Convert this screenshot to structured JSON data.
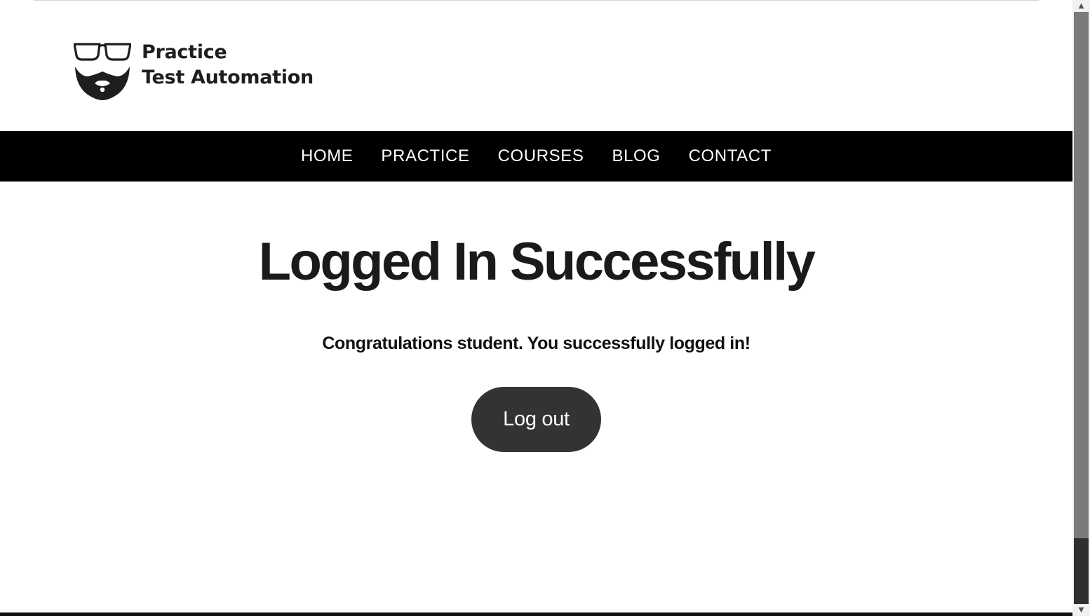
{
  "site": {
    "logo_line1": "Practice",
    "logo_line2": "Test Automation",
    "logo_icon": "glasses-beard-icon"
  },
  "nav": {
    "items": [
      {
        "label": "HOME"
      },
      {
        "label": "PRACTICE"
      },
      {
        "label": "COURSES"
      },
      {
        "label": "BLOG"
      },
      {
        "label": "CONTACT"
      }
    ]
  },
  "main": {
    "title": "Logged In Successfully",
    "message": "Congratulations student. You successfully logged in!",
    "logout_label": "Log out"
  },
  "colors": {
    "nav_background": "#000000",
    "nav_text": "#ffffff",
    "button_background": "#333333",
    "button_text": "#ffffff",
    "heading_text": "#1a1a1a"
  },
  "scrollbar": {
    "up_icon": "arrow-up-icon",
    "down_icon": "arrow-down-icon"
  }
}
